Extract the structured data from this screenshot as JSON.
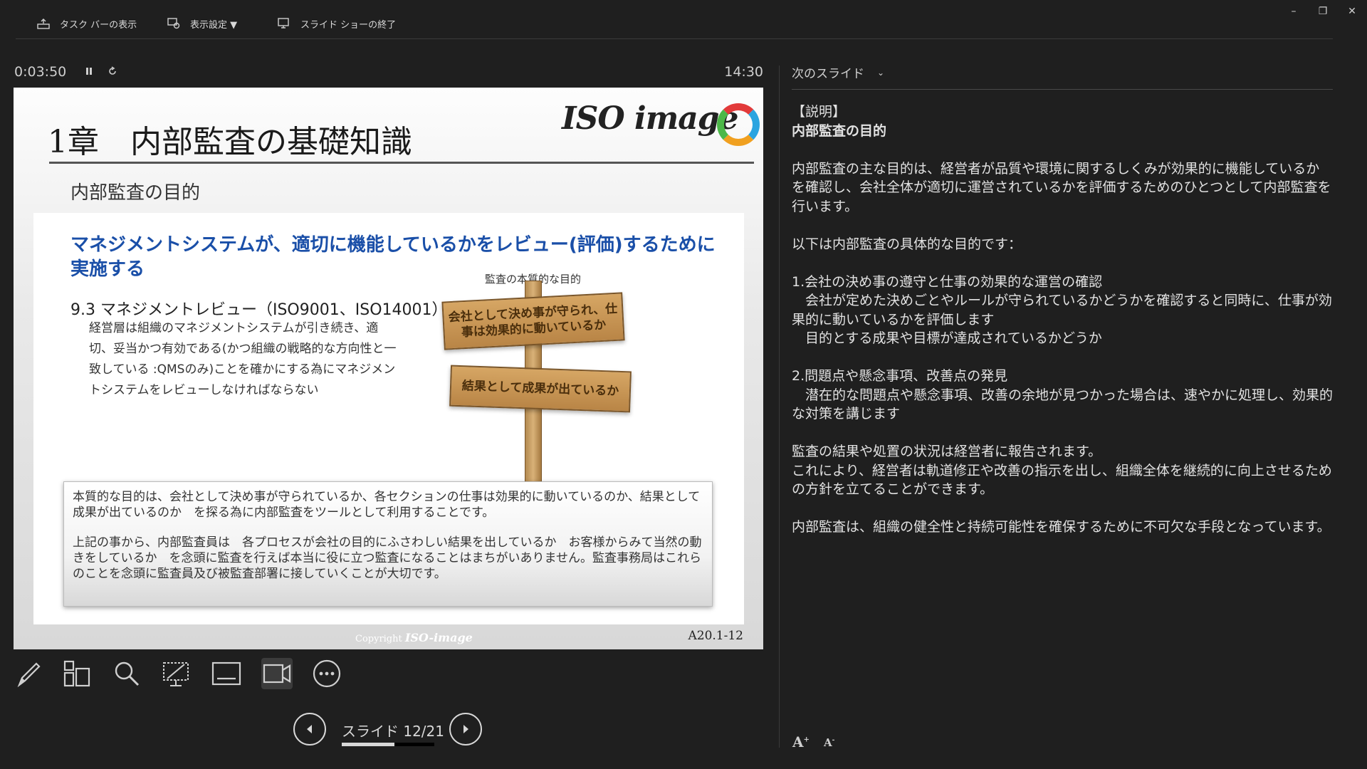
{
  "topbar": {
    "taskbar_label": "タスク バーの表示",
    "display_settings_label": "表示設定 ▼",
    "end_show_label": "スライド ショーの終了"
  },
  "window_controls": {
    "minimize": "–",
    "restore": "❐",
    "close": "✕"
  },
  "timer": {
    "elapsed": "0:03:50",
    "pause_icon": "pause-icon",
    "restart_icon": "restart-icon",
    "clock": "14:30"
  },
  "slide": {
    "title": "1章　内部監査の基礎知識",
    "logo_text": "ISO image",
    "subtitle": "内部監査の目的",
    "blue_heading": "マネジメントシステムが、適切に機能しているかをレビュー(評価)するために実施する",
    "section_heading": "9.3 マネジメントレビュー（ISO9001、ISO14001）",
    "section_body": "経営層は組織のマネジメントシステムが引き続き、適切、妥当かつ有効である(かつ組織の戦略的な方向性と一致している :QMSのみ)ことを確かにする為にマネジメントシステムをレビューしなければならない",
    "sign_caption": "監査の本質的な目的",
    "sign_top": "会社として決め事が守られ、仕事は効果的に動いているか",
    "sign_bottom": "結果として成果が出ているか",
    "note_p1": "本質的な目的は、会社として決め事が守られているか、各セクションの仕事は効果的に動いているのか、結果として成果が出ているのか　を探る為に内部監査をツールとして利用することです。",
    "note_p2": "上記の事から、内部監査員は　各プロセスが会社の目的にふさわしい結果を出しているか　お客様からみて当然の動きをしているか　を念頭に監査を行えば本当に役に立つ監査になることはまちがいありません。監査事務局はこれらのことを念頭に監査員及び被監査部署に接していくことが大切です。",
    "copyright_label": "Copyright",
    "copyright_logo": "ISO-image",
    "code": "A20.1-12"
  },
  "tools": [
    "pen-icon",
    "all-slides-icon",
    "zoom-icon",
    "pointer-icon",
    "subtitles-icon",
    "camera-icon",
    "more-options-icon"
  ],
  "navigation": {
    "counter": "スライド 12/21",
    "progress": 0.571
  },
  "right_pane": {
    "next_slide_label": "次のスライド",
    "notes": [
      "【説明】",
      "内部監査の目的",
      "",
      "内部監査の主な目的は、経営者が品質や環境に関するしくみが効果的に機能しているかを確認し、会社全体が適切に運営されているかを評価するためのひとつとして内部監査を行います。",
      "",
      "以下は内部監査の具体的な目的です：",
      "",
      "1.会社の決め事の遵守と仕事の効果的な運営の確認",
      "　会社が定めた決めごとやルールが守られているかどうかを確認すると同時に、仕事が効果的に動いているかを評価します",
      "　目的とする成果や目標が達成されているかどうか",
      "",
      "2.問題点や懸念事項、改善点の発見",
      "　潜在的な問題点や懸念事項、改善の余地が見つかった場合は、速やかに処理し、効果的な対策を講じます",
      "",
      "監査の結果や処置の状況は経営者に報告されます。",
      "これにより、経営者は軌道修正や改善の指示を出し、組織全体を継続的に向上させるための方針を立てることができます。",
      "",
      "内部監査は、組織の健全性と持続可能性を確保するために不可欠な手段となっています。"
    ],
    "font_increase": "A",
    "font_decrease": "A"
  }
}
